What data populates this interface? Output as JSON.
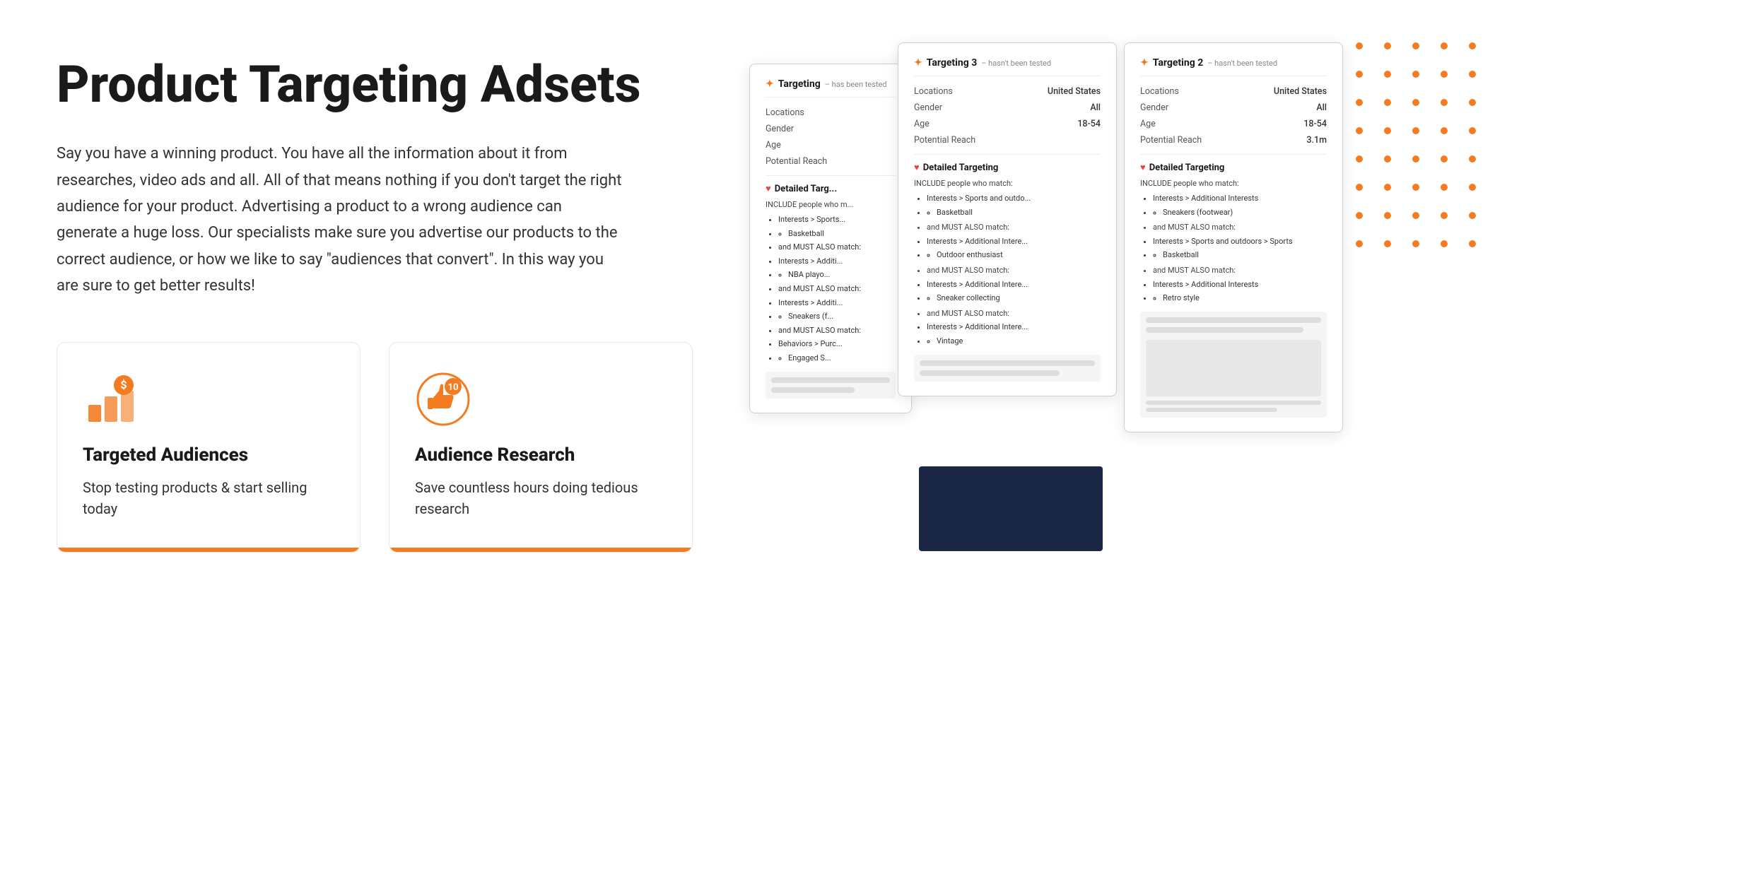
{
  "hero": {
    "title": "Product Targeting Adsets",
    "description": "Say you have a winning product. You have all the information about it from researches, video ads and all. All of that means nothing if you don't target the right audience for your product. Advertising a product to a wrong audience can generate a huge loss. Our specialists make sure you advertise our products to the correct audience, or how we like to say \"audiences that convert\". In this way you are sure to get better results!"
  },
  "cards": [
    {
      "id": "targeted-audiences",
      "title": "Targeted Audiences",
      "description": "Stop testing products & start selling today"
    },
    {
      "id": "audience-research",
      "title": "Audience Research",
      "description": "Save countless hours doing tedious research"
    }
  ],
  "adsets": {
    "card1": {
      "title": "Targeting",
      "subtitle": "– has been tested",
      "rows": [
        {
          "label": "Locations",
          "value": ""
        },
        {
          "label": "Gender",
          "value": ""
        },
        {
          "label": "Age",
          "value": ""
        },
        {
          "label": "Potential Reach",
          "value": ""
        }
      ],
      "detailed_targeting": "Detailed Targ...",
      "include_text": "INCLUDE people who m...",
      "interests": [
        "Interests > Sports...",
        "Basketball",
        "NBA playo...",
        "Additic...",
        "Sneakers (f...",
        "Behaviors > Purc...",
        "Engaged S..."
      ]
    },
    "card2": {
      "title": "Targeting 3",
      "subtitle": "– hasn't been tested",
      "rows": [
        {
          "label": "Locations",
          "value": "United States"
        },
        {
          "label": "Gender",
          "value": "All"
        },
        {
          "label": "Age",
          "value": "18-54"
        },
        {
          "label": "Potential Reach",
          "value": ""
        }
      ],
      "detailed_targeting": "Detailed Targeting",
      "include_text": "INCLUDE people who match:",
      "interests": [
        {
          "main": "Interests > Sports and outdo...",
          "sub": [
            "Basketball"
          ]
        },
        {
          "main": "Interests > Additional Intere...",
          "sub": [
            "Outdoor enthusiast"
          ]
        },
        {
          "main": "Interests > Additional Intere...",
          "sub": [
            "Sneaker collecting"
          ]
        },
        {
          "main": "Interests > Additional Intere...",
          "sub": [
            "Vintage"
          ]
        }
      ]
    },
    "card3": {
      "title": "Targeting 2",
      "subtitle": "– hasn't been tested",
      "rows": [
        {
          "label": "Locations",
          "value": "United States"
        },
        {
          "label": "Gender",
          "value": "All"
        },
        {
          "label": "Age",
          "value": "18-54"
        },
        {
          "label": "Potential Reach",
          "value": "3.1m"
        }
      ],
      "detailed_targeting": "Detailed Targeting",
      "include_text": "INCLUDE people who match:",
      "interests": [
        {
          "main": "Interests > Additional Interests",
          "sub": [
            "Sneakers (footwear)"
          ]
        },
        {
          "main": "Interests > Sports and outdoors > Sports",
          "sub": [
            "Basketball"
          ]
        },
        {
          "main": "Interests > Additional Interests",
          "sub": [
            "Retro style"
          ]
        }
      ]
    }
  },
  "colors": {
    "accent": "#f47b20",
    "dark_bg": "#1a2744",
    "card_border": "#e0e0e0"
  }
}
